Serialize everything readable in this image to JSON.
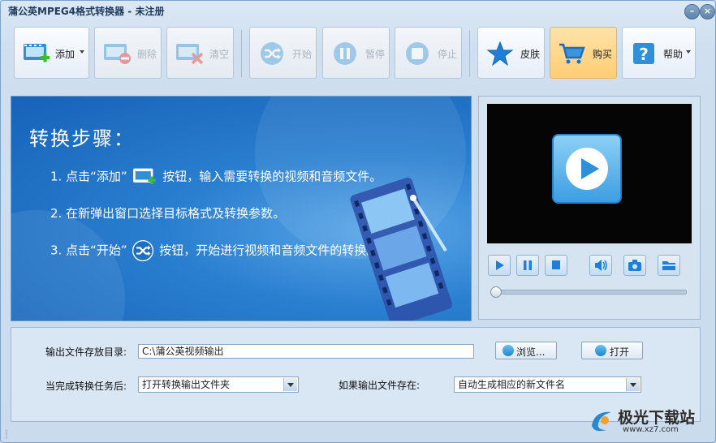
{
  "window": {
    "title": "蒲公英MPEG4格式转换器 - 未注册"
  },
  "toolbar": {
    "add": "添加",
    "delete": "删除",
    "clear": "清空",
    "start": "开始",
    "pause": "暂停",
    "stop": "停止",
    "skin": "皮肤",
    "buy": "购买",
    "help": "帮助"
  },
  "banner": {
    "heading": "转换步骤：",
    "step1_a": "1. 点击“添加”",
    "step1_b": "按钮，输入需要转换的视频和音频文件。",
    "step2": "2. 在新弹出窗口选择目标格式及转换参数。",
    "step3_a": "3. 点击“开始”",
    "step3_b": "按钮，开始进行视频和音频文件的转换。"
  },
  "output": {
    "dir_label": "输出文件存放目录:",
    "dir_value": "C:\\蒲公英视频输出",
    "browse": "浏览...",
    "open": "打开",
    "after_label": "当完成转换任务后:",
    "after_value": "打开转换输出文件夹",
    "exists_label": "如果输出文件存在:",
    "exists_value": "自动生成相应的新文件名"
  },
  "watermark": {
    "name": "极光下载站",
    "url": "www.xz7.com"
  },
  "colors": {
    "accent": "#1c86d0",
    "buy_bg": "#ffcd74",
    "banner": "#2a7fd0"
  }
}
